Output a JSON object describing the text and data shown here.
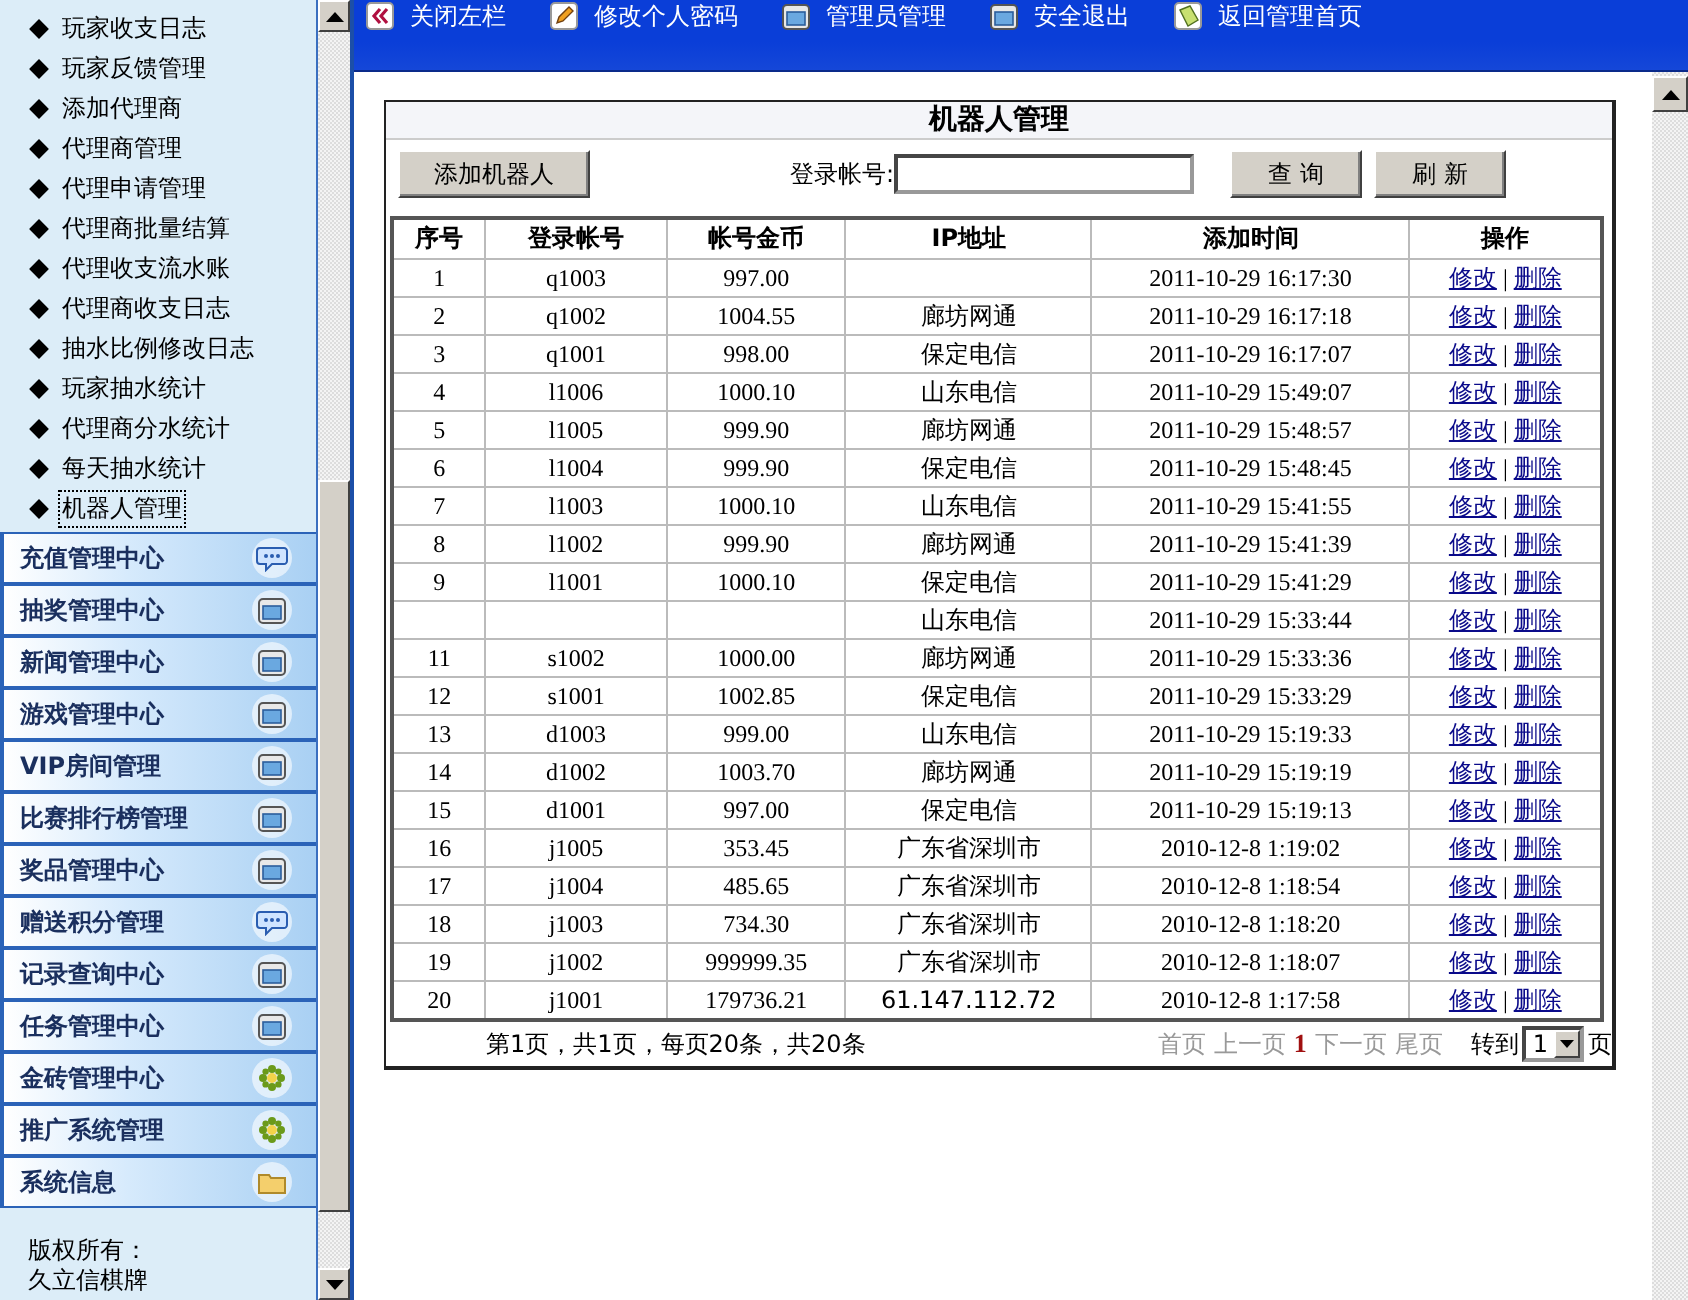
{
  "sidebar": {
    "items": [
      {
        "label": "玩家收支日志",
        "selected": false
      },
      {
        "label": "玩家反馈管理",
        "selected": false
      },
      {
        "label": "添加代理商",
        "selected": false
      },
      {
        "label": "代理商管理",
        "selected": false
      },
      {
        "label": "代理申请管理",
        "selected": false
      },
      {
        "label": "代理商批量结算",
        "selected": false
      },
      {
        "label": "代理收支流水账",
        "selected": false
      },
      {
        "label": "代理商收支日志",
        "selected": false
      },
      {
        "label": "抽水比例修改日志",
        "selected": false
      },
      {
        "label": "玩家抽水统计",
        "selected": false
      },
      {
        "label": "代理商分水统计",
        "selected": false
      },
      {
        "label": "每天抽水统计",
        "selected": false
      },
      {
        "label": "机器人管理",
        "selected": true
      }
    ],
    "sections": [
      {
        "label": "充值管理中心",
        "kind": "chat"
      },
      {
        "label": "抽奖管理中心",
        "kind": "window"
      },
      {
        "label": "新闻管理中心",
        "kind": "window"
      },
      {
        "label": "游戏管理中心",
        "kind": "window"
      },
      {
        "label": "VIP房间管理",
        "kind": "window"
      },
      {
        "label": "比赛排行榜管理",
        "kind": "window"
      },
      {
        "label": "奖品管理中心",
        "kind": "window"
      },
      {
        "label": "赠送积分管理",
        "kind": "chat"
      },
      {
        "label": "记录查询中心",
        "kind": "window"
      },
      {
        "label": "任务管理中心",
        "kind": "window"
      },
      {
        "label": "金砖管理中心",
        "kind": "gear"
      },
      {
        "label": "推广系统管理",
        "kind": "gear"
      },
      {
        "label": "系统信息",
        "kind": "folder"
      }
    ],
    "copyright": [
      "版权所有：",
      "久立信棋牌"
    ]
  },
  "toolbar": [
    {
      "label": "关闭左栏",
      "kind": "collapse"
    },
    {
      "label": "修改个人密码",
      "kind": "pencil"
    },
    {
      "label": "管理员管理",
      "kind": "window"
    },
    {
      "label": "安全退出",
      "kind": "window"
    },
    {
      "label": "返回管理首页",
      "kind": "home"
    }
  ],
  "panel": {
    "title": "机器人管理",
    "add_button": "添加机器人",
    "search": {
      "label": "登录帐号:"
    },
    "query_button": "查 询",
    "refresh_button": "刷 新",
    "table": {
      "columns": [
        "序号",
        "登录帐号",
        "帐号金币",
        "IP地址",
        "添加时间",
        "操作"
      ],
      "rows": [
        {
          "no": "1",
          "account": "q1003",
          "gold": "997.00",
          "time": "2011-10-29 16:17:30",
          "edit": "修改",
          "sep": "|",
          "delete": "删除"
        },
        {
          "no": "2",
          "account": "q1002",
          "gold": "1004.55",
          "ip": "廊坊网通",
          "time": "2011-10-29 16:17:18",
          "edit": "修改",
          "sep": "|",
          "delete": "删除"
        },
        {
          "no": "3",
          "account": "q1001",
          "gold": "998.00",
          "ip": "保定电信",
          "time": "2011-10-29 16:17:07",
          "edit": "修改",
          "sep": "|",
          "delete": "删除"
        },
        {
          "no": "4",
          "account": "l1006",
          "gold": "1000.10",
          "ip": "山东电信",
          "time": "2011-10-29 15:49:07",
          "edit": "修改",
          "sep": "|",
          "delete": "删除"
        },
        {
          "no": "5",
          "account": "l1005",
          "gold": "999.90",
          "ip": "廊坊网通",
          "time": "2011-10-29 15:48:57",
          "edit": "修改",
          "sep": "|",
          "delete": "删除"
        },
        {
          "no": "6",
          "account": "l1004",
          "gold": "999.90",
          "ip": "保定电信",
          "time": "2011-10-29 15:48:45",
          "edit": "修改",
          "sep": "|",
          "delete": "删除"
        },
        {
          "no": "7",
          "account": "l1003",
          "gold": "1000.10",
          "ip": "山东电信",
          "time": "2011-10-29 15:41:55",
          "edit": "修改",
          "sep": "|",
          "delete": "删除"
        },
        {
          "no": "8",
          "account": "l1002",
          "gold": "999.90",
          "ip": "廊坊网通",
          "time": "2011-10-29 15:41:39",
          "edit": "修改",
          "sep": "|",
          "delete": "删除"
        },
        {
          "no": "9",
          "account": "l1001",
          "gold": "1000.10",
          "ip": "保定电信",
          "time": "2011-10-29 15:41:29",
          "edit": "修改",
          "sep": "|",
          "delete": "删除"
        },
        {
          "ip": "山东电信",
          "time": "2011-10-29 15:33:44",
          "edit": "修改",
          "sep": "|",
          "delete": "删除"
        },
        {
          "no": "11",
          "account": "s1002",
          "gold": "1000.00",
          "ip": "廊坊网通",
          "time": "2011-10-29 15:33:36",
          "edit": "修改",
          "sep": "|",
          "delete": "删除"
        },
        {
          "no": "12",
          "account": "s1001",
          "gold": "1002.85",
          "ip": "保定电信",
          "time": "2011-10-29 15:33:29",
          "edit": "修改",
          "sep": "|",
          "delete": "删除"
        },
        {
          "no": "13",
          "account": "d1003",
          "gold": "999.00",
          "ip": "山东电信",
          "time": "2011-10-29 15:19:33",
          "edit": "修改",
          "sep": "|",
          "delete": "删除"
        },
        {
          "no": "14",
          "account": "d1002",
          "gold": "1003.70",
          "ip": "廊坊网通",
          "time": "2011-10-29 15:19:19",
          "edit": "修改",
          "sep": "|",
          "delete": "删除"
        },
        {
          "no": "15",
          "account": "d1001",
          "gold": "997.00",
          "ip": "保定电信",
          "time": "2011-10-29 15:19:13",
          "edit": "修改",
          "sep": "|",
          "delete": "删除"
        },
        {
          "no": "16",
          "account": "j1005",
          "gold": "353.45",
          "ip": "广东省深圳市",
          "time": "2010-12-8 1:19:02",
          "edit": "修改",
          "sep": "|",
          "delete": "删除"
        },
        {
          "no": "17",
          "account": "j1004",
          "gold": "485.65",
          "ip": "广东省深圳市",
          "time": "2010-12-8 1:18:54",
          "edit": "修改",
          "sep": "|",
          "delete": "删除"
        },
        {
          "no": "18",
          "account": "j1003",
          "gold": "734.30",
          "ip": "广东省深圳市",
          "time": "2010-12-8 1:18:20",
          "edit": "修改",
          "sep": "|",
          "delete": "删除"
        },
        {
          "no": "19",
          "account": "j1002",
          "gold": "999999.35",
          "ip": "广东省深圳市",
          "time": "2010-12-8 1:18:07",
          "edit": "修改",
          "sep": "|",
          "delete": "删除"
        },
        {
          "no": "20",
          "account": "j1001",
          "gold": "179736.21",
          "ip": "61.147.112.72",
          "time": "2010-12-8 1:17:58",
          "edit": "修改",
          "sep": "|",
          "delete": "删除"
        }
      ]
    },
    "footer": {
      "summary": "第1页，共1页，每页20条，共20条",
      "links": [
        {
          "label": "首页",
          "kind": "link",
          "disabled": true
        },
        {
          "label": "上一页",
          "kind": "link",
          "disabled": true
        },
        {
          "label": "1",
          "kind": "current"
        },
        {
          "label": "下一页",
          "kind": "link",
          "disabled": true
        },
        {
          "label": "尾页",
          "kind": "link",
          "disabled": true
        }
      ],
      "goto_label": "转到",
      "page_select": "1",
      "suffix": "页"
    }
  }
}
